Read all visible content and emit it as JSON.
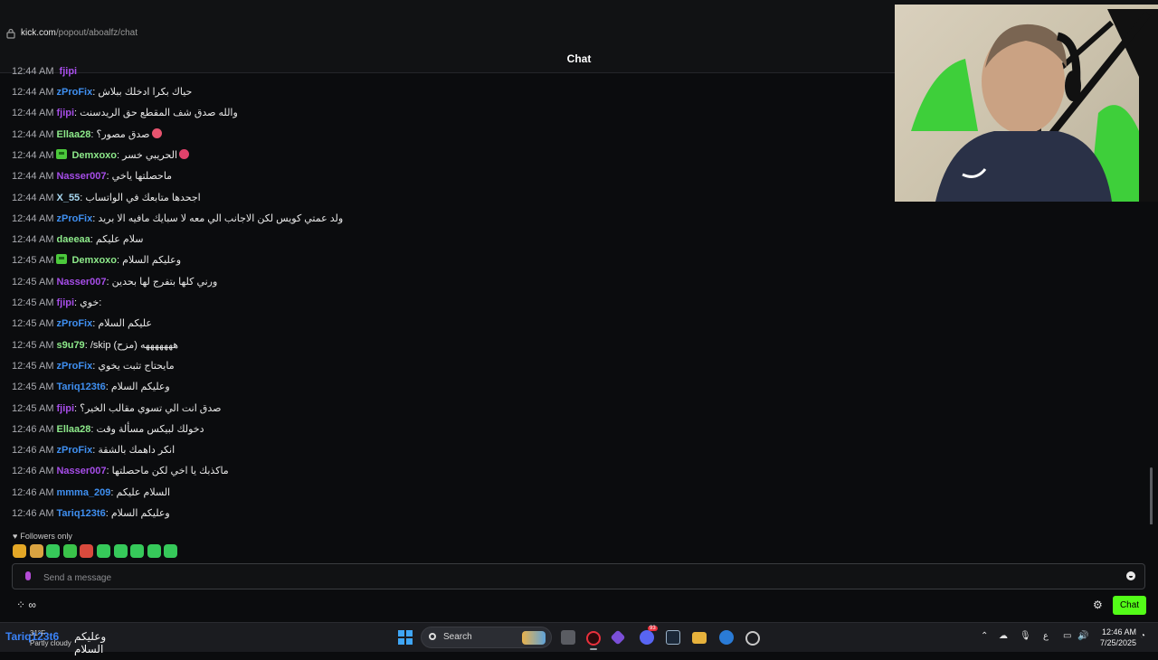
{
  "browser": {
    "url_host": "kick.com",
    "url_path": "/popout/aboalfz/chat"
  },
  "chat": {
    "title": "Chat",
    "top_partial": {
      "time": "12:44 AM",
      "user": "fjipi"
    },
    "messages": [
      {
        "time": "12:44 AM",
        "user": "zProFix",
        "color": "#3f8ff0",
        "text": "حياك بكرا ادخلك ببلاش",
        "badge": false
      },
      {
        "time": "12:44 AM",
        "user": "fjipi",
        "color": "#a64de8",
        "text": "والله صدق شف المقطع حق الريدسنت",
        "badge": false
      },
      {
        "time": "12:44 AM",
        "user": "Ellaa28",
        "color": "#8de98a",
        "text": "صدق مصور؟",
        "badge": false,
        "emoji": "#e8546f"
      },
      {
        "time": "12:44 AM",
        "user": "Demxoxo",
        "color": "#8de98a",
        "text": "الحريبي خسر",
        "badge": true,
        "emoji": "#e0426b"
      },
      {
        "time": "12:44 AM",
        "user": "Nasser007",
        "color": "#a64de8",
        "text": "ماحصلتها ياخي",
        "badge": false
      },
      {
        "time": "12:44 AM",
        "user": "X_55",
        "color": "#a8d8f0",
        "text": "اجحدها متابعك في الواتساب",
        "badge": false
      },
      {
        "time": "12:44 AM",
        "user": "zProFix",
        "color": "#3f8ff0",
        "text": "ولد عمتي كويس لكن الاجانب الي معه لا سبايك مافيه الا بريد",
        "badge": false
      },
      {
        "time": "12:44 AM",
        "user": "daeeaa",
        "color": "#8de98a",
        "text": "سلام عليكم",
        "badge": false
      },
      {
        "time": "12:45 AM",
        "user": "Demxoxo",
        "color": "#8de98a",
        "text": "وعليكم السلام",
        "badge": true
      },
      {
        "time": "12:45 AM",
        "user": "Nasser007",
        "color": "#a64de8",
        "text": "ورني كلها بتفرج لها بحدين",
        "badge": false
      },
      {
        "time": "12:45 AM",
        "user": "fjipi",
        "color": "#a64de8",
        "text": "خوي:",
        "badge": false
      },
      {
        "time": "12:45 AM",
        "user": "zProFix",
        "color": "#3f8ff0",
        "text": "عليكم السلام",
        "badge": false
      },
      {
        "time": "12:45 AM",
        "user": "s9u79",
        "color": "#8de98a",
        "text": "/skip (مزح) هههههههه",
        "badge": false
      },
      {
        "time": "12:45 AM",
        "user": "zProFix",
        "color": "#3f8ff0",
        "text": "مايحتاج تثبت يخوي",
        "badge": false
      },
      {
        "time": "12:45 AM",
        "user": "Tariq123t6",
        "color": "#3f8ff0",
        "text": "وعليكم السلام",
        "badge": false
      },
      {
        "time": "12:45 AM",
        "user": "fjipi",
        "color": "#a64de8",
        "text": "صدق انت الي تسوي مقالب الخير؟",
        "badge": false
      },
      {
        "time": "12:46 AM",
        "user": "Ellaa28",
        "color": "#8de98a",
        "text": "دخولك لبيكس مسألة وقت",
        "badge": false
      },
      {
        "time": "12:46 AM",
        "user": "zProFix",
        "color": "#3f8ff0",
        "text": "انكر داهمك بالشقة",
        "badge": false
      },
      {
        "time": "12:46 AM",
        "user": "Nasser007",
        "color": "#a64de8",
        "text": "ماكذبك يا اخي لكن ماحصلتها",
        "badge": false
      },
      {
        "time": "12:46 AM",
        "user": "mmma_209",
        "color": "#3f8ff0",
        "text": "السلام عليكم",
        "badge": false
      },
      {
        "time": "12:46 AM",
        "user": "Tariq123t6",
        "color": "#3f8ff0",
        "text": "وعليكم السلام",
        "badge": false
      }
    ],
    "followers_only": "Followers only",
    "emote_colors": [
      "#e3a726",
      "#d9a341",
      "#36c95a",
      "#3ac34a",
      "#d94a3d",
      "#36c95a",
      "#36c95a",
      "#36c95a",
      "#36c95a",
      "#36c95a"
    ],
    "input_placeholder": "Send a message",
    "send_button": "Chat",
    "accent": "#53fc18"
  },
  "taskbar": {
    "preview_user": "Tariq123t6",
    "preview_text": "وعليكم السلام",
    "weather_temp": "31°F",
    "weather_condition": "Partly cloudy",
    "search_label": "Search",
    "language": "ع",
    "time": "12:46 AM",
    "date": "7/25/2025",
    "discord_badge": "93"
  }
}
